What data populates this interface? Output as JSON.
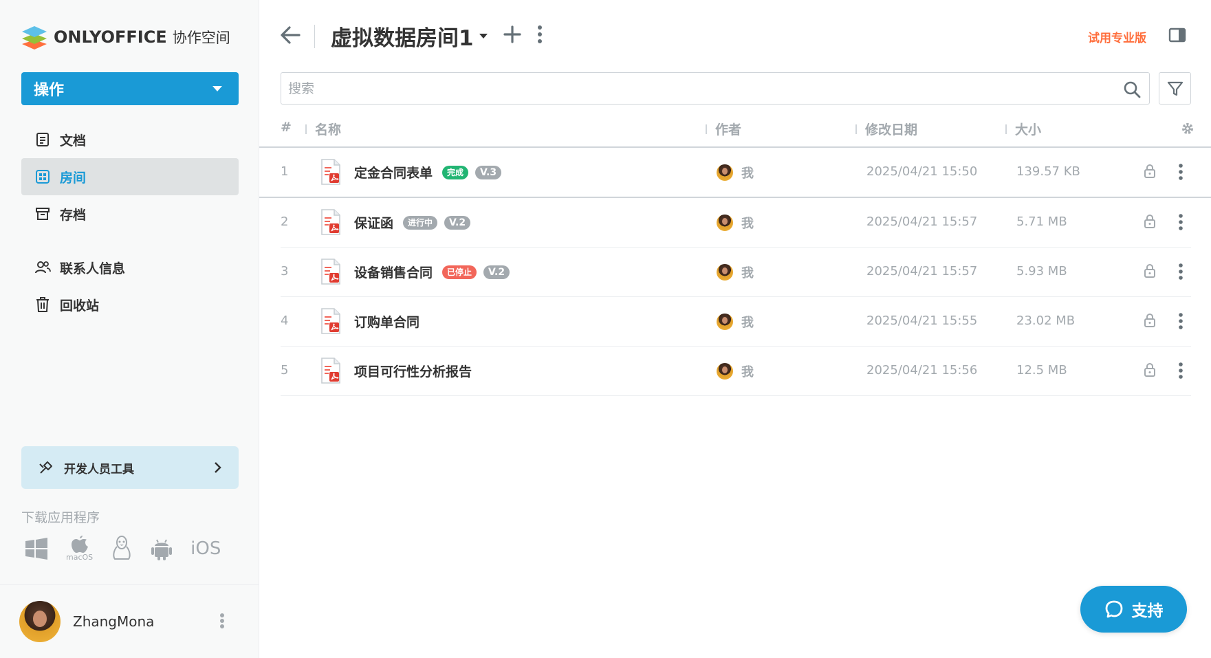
{
  "brand": {
    "name": "ONLYOFFICE",
    "subtitle": "协作空间"
  },
  "sidebar": {
    "actions_label": "操作",
    "items": [
      {
        "label": "文档",
        "icon": "document-icon",
        "active": false
      },
      {
        "label": "房间",
        "icon": "rooms-grid-icon",
        "active": true
      },
      {
        "label": "存档",
        "icon": "archive-icon",
        "active": false
      },
      {
        "label": "联系人信息",
        "icon": "contacts-icon",
        "active": false
      },
      {
        "label": "回收站",
        "icon": "trash-icon",
        "active": false
      }
    ],
    "dev_tools_label": "开发人员工具",
    "download_title": "下载应用程序",
    "platforms": {
      "windows": "windows-icon",
      "macos": "macOS",
      "linux": "linux-icon",
      "android": "android-icon",
      "ios": "iOS"
    },
    "user": {
      "name": "ZhangMona"
    }
  },
  "header": {
    "room_title": "虚拟数据房间1",
    "trial_label": "试用专业版"
  },
  "search": {
    "placeholder": "搜索"
  },
  "table": {
    "columns": {
      "index": "#",
      "name": "名称",
      "author": "作者",
      "modified": "修改日期",
      "size": "大小"
    },
    "rows": [
      {
        "index": "1",
        "name": "定金合同表单",
        "status": "完成",
        "status_color": "#22b573",
        "version": "V.3",
        "author": "我",
        "modified": "2025/04/21 15:50",
        "size": "139.57 KB"
      },
      {
        "index": "2",
        "name": "保证函",
        "status": "进行中",
        "status_color": "#a3a9ae",
        "version": "V.2",
        "author": "我",
        "modified": "2025/04/21 15:57",
        "size": "5.71 MB"
      },
      {
        "index": "3",
        "name": "设备销售合同",
        "status": "已停止",
        "status_color": "#f2665a",
        "version": "V.2",
        "author": "我",
        "modified": "2025/04/21 15:57",
        "size": "5.93 MB"
      },
      {
        "index": "4",
        "name": "订购单合同",
        "status": "",
        "status_color": "",
        "version": "",
        "author": "我",
        "modified": "2025/04/21 15:55",
        "size": "23.02 MB"
      },
      {
        "index": "5",
        "name": "项目可行性分析报告",
        "status": "",
        "status_color": "",
        "version": "",
        "author": "我",
        "modified": "2025/04/21 15:56",
        "size": "12.5 MB"
      }
    ]
  },
  "support": {
    "label": "支持"
  },
  "colors": {
    "accent": "#1a9ad6",
    "trial": "#ff6f3d",
    "muted": "#a3a9ae"
  }
}
